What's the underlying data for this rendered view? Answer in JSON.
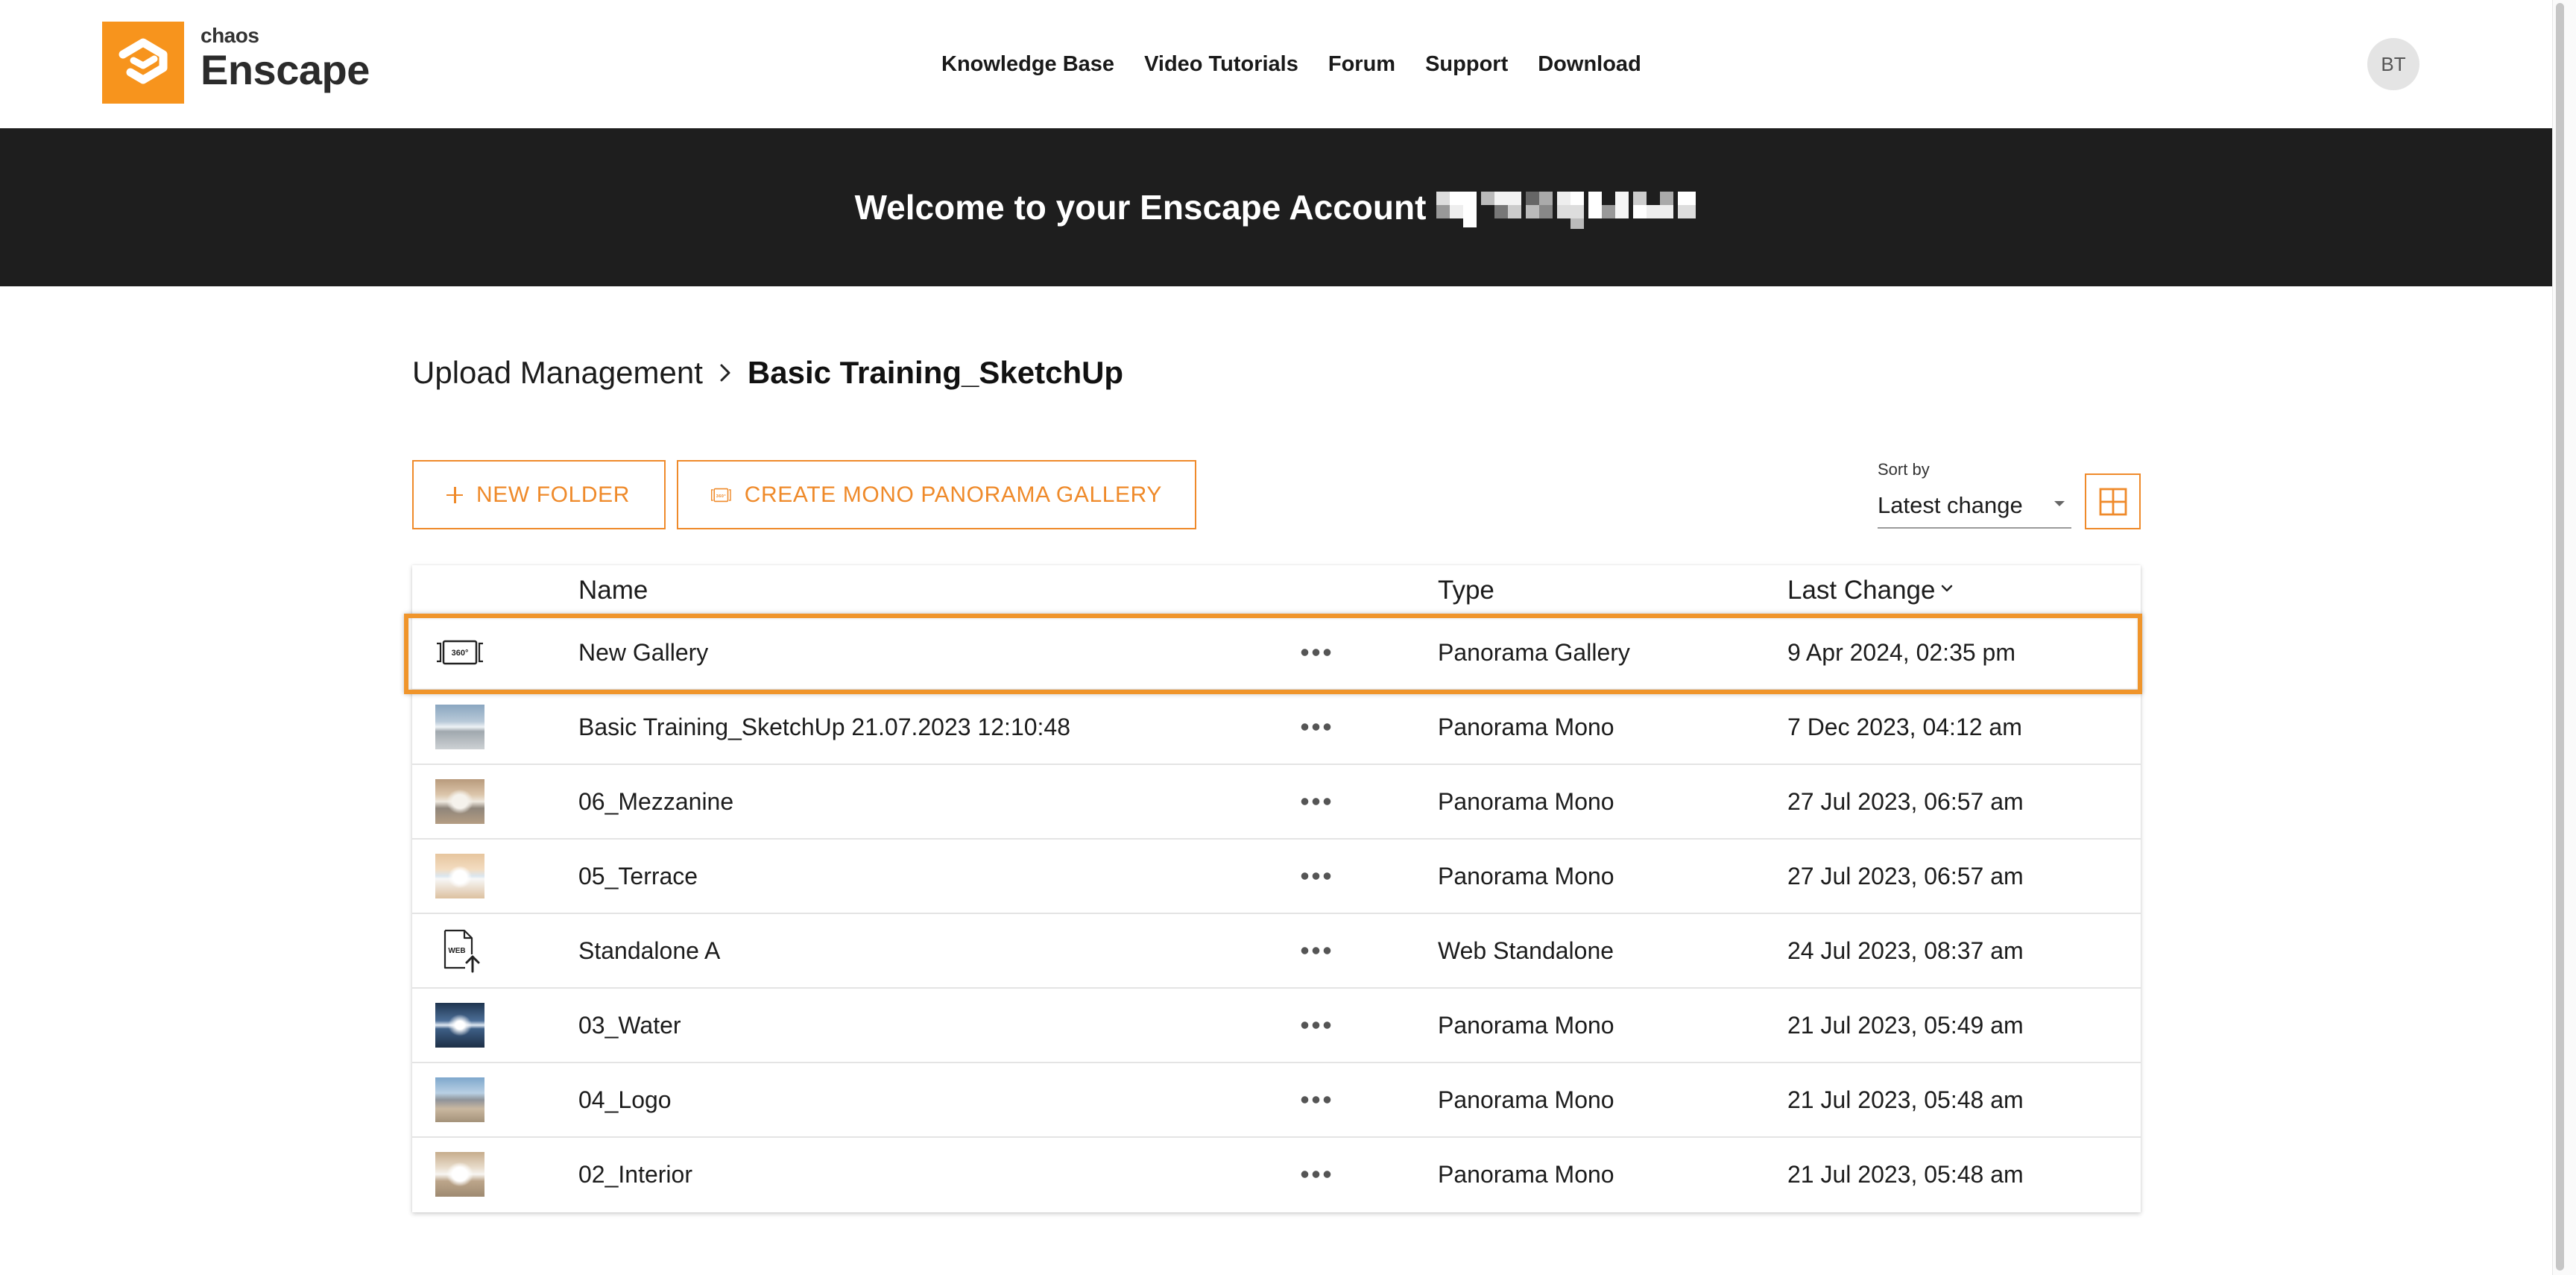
{
  "app": {
    "logo": {
      "brand_small": "chaos",
      "brand_large": "Enscape",
      "icon": "enscape-logo-icon"
    },
    "nav": [
      {
        "label": "Knowledge Base"
      },
      {
        "label": "Video Tutorials"
      },
      {
        "label": "Forum"
      },
      {
        "label": "Support"
      },
      {
        "label": "Download"
      }
    ],
    "avatar": {
      "initials": "BT"
    }
  },
  "banner": {
    "title": "Welcome to your Enscape Account",
    "redacted_icon": "redacted-username-block"
  },
  "breadcrumb": {
    "parent": "Upload Management",
    "separator_icon": "chevron-right-icon",
    "current": "Basic Training_SketchUp"
  },
  "toolbar": {
    "new_folder": {
      "label": "NEW FOLDER",
      "icon": "plus-icon"
    },
    "create_gallery": {
      "label": "CREATE MONO PANORAMA GALLERY",
      "icon": "panorama-gallery-icon",
      "icon_text": "360°"
    },
    "sort": {
      "label": "Sort by",
      "value": "Latest change",
      "icon": "caret-down-icon"
    },
    "view_toggle_icon": "grid-view-icon"
  },
  "table": {
    "columns": {
      "name": "Name",
      "type": "Type",
      "last_change": "Last Change"
    },
    "sort_indicator_icon": "chevron-down-icon",
    "row_menu_icon": "more-options-icon",
    "rows": [
      {
        "name": "New Gallery",
        "type": "Panorama Gallery",
        "last_change": "9 Apr 2024, 02:35 pm",
        "icon": "gallery-360-icon",
        "icon_text": "360°",
        "highlighted": true
      },
      {
        "name": "Basic Training_SketchUp 21.07.2023 12:10:48",
        "type": "Panorama Mono",
        "last_change": "7 Dec 2023, 04:12 am",
        "icon": "panorama-thumbnail"
      },
      {
        "name": "06_Mezzanine",
        "type": "Panorama Mono",
        "last_change": "27 Jul 2023, 06:57 am",
        "icon": "panorama-thumbnail"
      },
      {
        "name": "05_Terrace",
        "type": "Panorama Mono",
        "last_change": "27 Jul 2023, 06:57 am",
        "icon": "panorama-thumbnail"
      },
      {
        "name": "Standalone A",
        "type": "Web Standalone",
        "last_change": "24 Jul 2023, 08:37 am",
        "icon": "web-standalone-icon",
        "icon_text": "WEB"
      },
      {
        "name": "03_Water",
        "type": "Panorama Mono",
        "last_change": "21 Jul 2023, 05:49 am",
        "icon": "panorama-thumbnail"
      },
      {
        "name": "04_Logo",
        "type": "Panorama Mono",
        "last_change": "21 Jul 2023, 05:48 am",
        "icon": "panorama-thumbnail"
      },
      {
        "name": "02_Interior",
        "type": "Panorama Mono",
        "last_change": "21 Jul 2023, 05:48 am",
        "icon": "panorama-thumbnail"
      }
    ]
  },
  "colors": {
    "accent": "#ef8a2a",
    "banner": "#1e1e1e",
    "logo": "#f7941d",
    "text": "#1c1c1c"
  }
}
